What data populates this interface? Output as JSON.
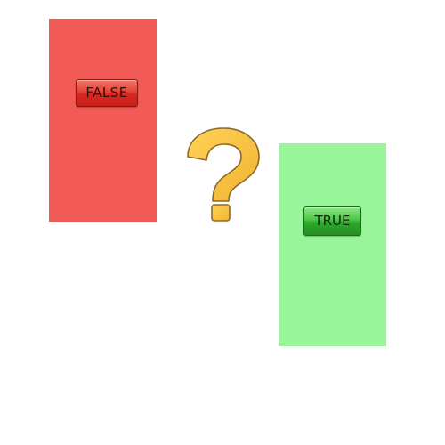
{
  "panels": {
    "false_panel": {
      "color": "#f25a55"
    },
    "true_panel": {
      "color": "#98f59a"
    }
  },
  "buttons": {
    "false_label": "FALSE",
    "true_label": "TRUE"
  },
  "icons": {
    "center": "question-mark-icon",
    "color": "#f5c242"
  }
}
